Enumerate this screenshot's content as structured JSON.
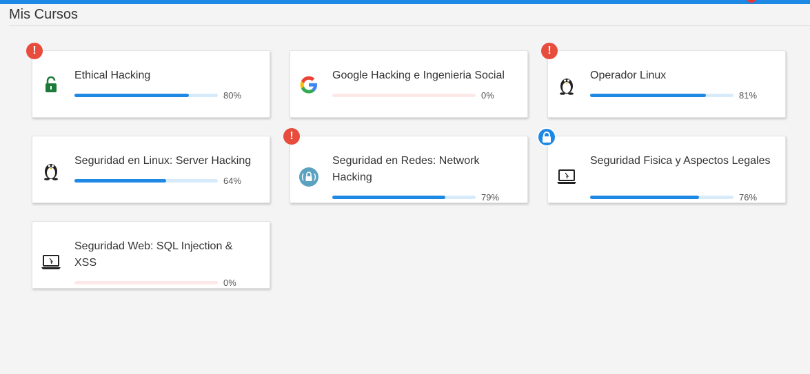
{
  "header": {
    "title": "Mis Cursos"
  },
  "courses": [
    {
      "title": "Ethical Hacking",
      "progress_label": "80%",
      "progress": 80,
      "icon": "unlock-icon",
      "badge": "alert-icon"
    },
    {
      "title": "Google Hacking e Ingenieria Social",
      "progress_label": "0%",
      "progress": 0,
      "icon": "google-icon",
      "badge": ""
    },
    {
      "title": "Operador Linux",
      "progress_label": "81%",
      "progress": 81,
      "icon": "linux-penguin-icon",
      "badge": "alert-icon"
    },
    {
      "title": "Seguridad en Linux: Server Hacking",
      "progress_label": "64%",
      "progress": 64,
      "icon": "linux-penguin-icon",
      "badge": ""
    },
    {
      "title": "Seguridad en Redes: Network Hacking",
      "progress_label": "79%",
      "progress": 79,
      "icon": "network-lock-icon",
      "badge": "alert-icon"
    },
    {
      "title": "Seguridad Fisica y Aspectos Legales",
      "progress_label": "76%",
      "progress": 76,
      "icon": "laptop-icon",
      "badge": "lock-icon"
    },
    {
      "title": "Seguridad Web: SQL Injection & XSS",
      "progress_label": "0%",
      "progress": 0,
      "icon": "laptop-icon",
      "badge": ""
    }
  ],
  "colors": {
    "accent": "#1e88e5",
    "alert": "#e74c3c",
    "track": "#d7ebfb",
    "empty_track": "#fde8e8"
  }
}
